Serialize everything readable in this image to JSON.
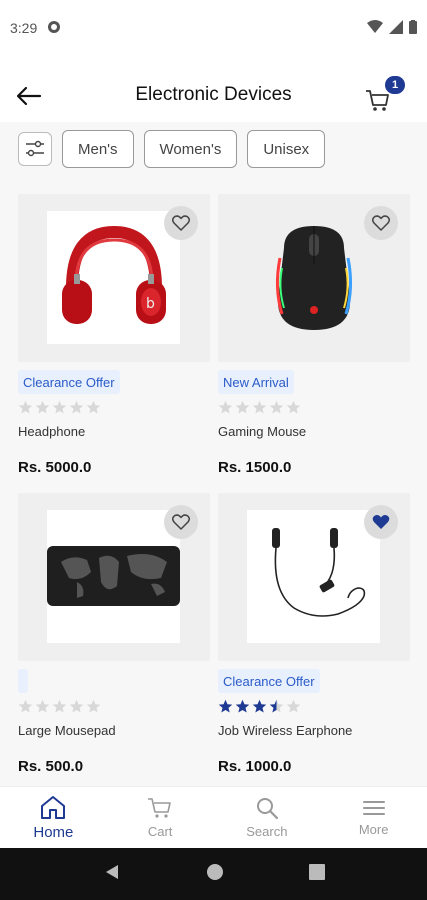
{
  "status_bar": {
    "time": "3:29"
  },
  "header": {
    "title": "Electronic Devices",
    "cart_count": "1"
  },
  "filters": {
    "chips": [
      "Men's",
      "Women's",
      "Unisex"
    ]
  },
  "products": [
    {
      "tag": "Clearance Offer",
      "name": "Headphone",
      "price": "Rs. 5000.0",
      "rating": 0,
      "favorite": false
    },
    {
      "tag": "New Arrival",
      "name": "Gaming Mouse",
      "price": "Rs. 1500.0",
      "rating": 0,
      "favorite": false
    },
    {
      "tag": "",
      "name": "Large Mousepad",
      "price": "Rs. 500.0",
      "rating": 0,
      "favorite": false
    },
    {
      "tag": "Clearance Offer",
      "name": "Job Wireless Earphone",
      "price": "Rs. 1000.0",
      "rating": 3.5,
      "favorite": true
    }
  ],
  "bottom_nav": [
    {
      "label": "Home",
      "icon": "home-icon",
      "active": true
    },
    {
      "label": "Cart",
      "icon": "cart-icon",
      "active": false
    },
    {
      "label": "Search",
      "icon": "search-icon",
      "active": false
    },
    {
      "label": "More",
      "icon": "menu-icon",
      "active": false
    }
  ],
  "colors": {
    "accent": "#1f3a93",
    "tag_bg": "#e8f0fe",
    "tag_text": "#2a5bc7"
  }
}
